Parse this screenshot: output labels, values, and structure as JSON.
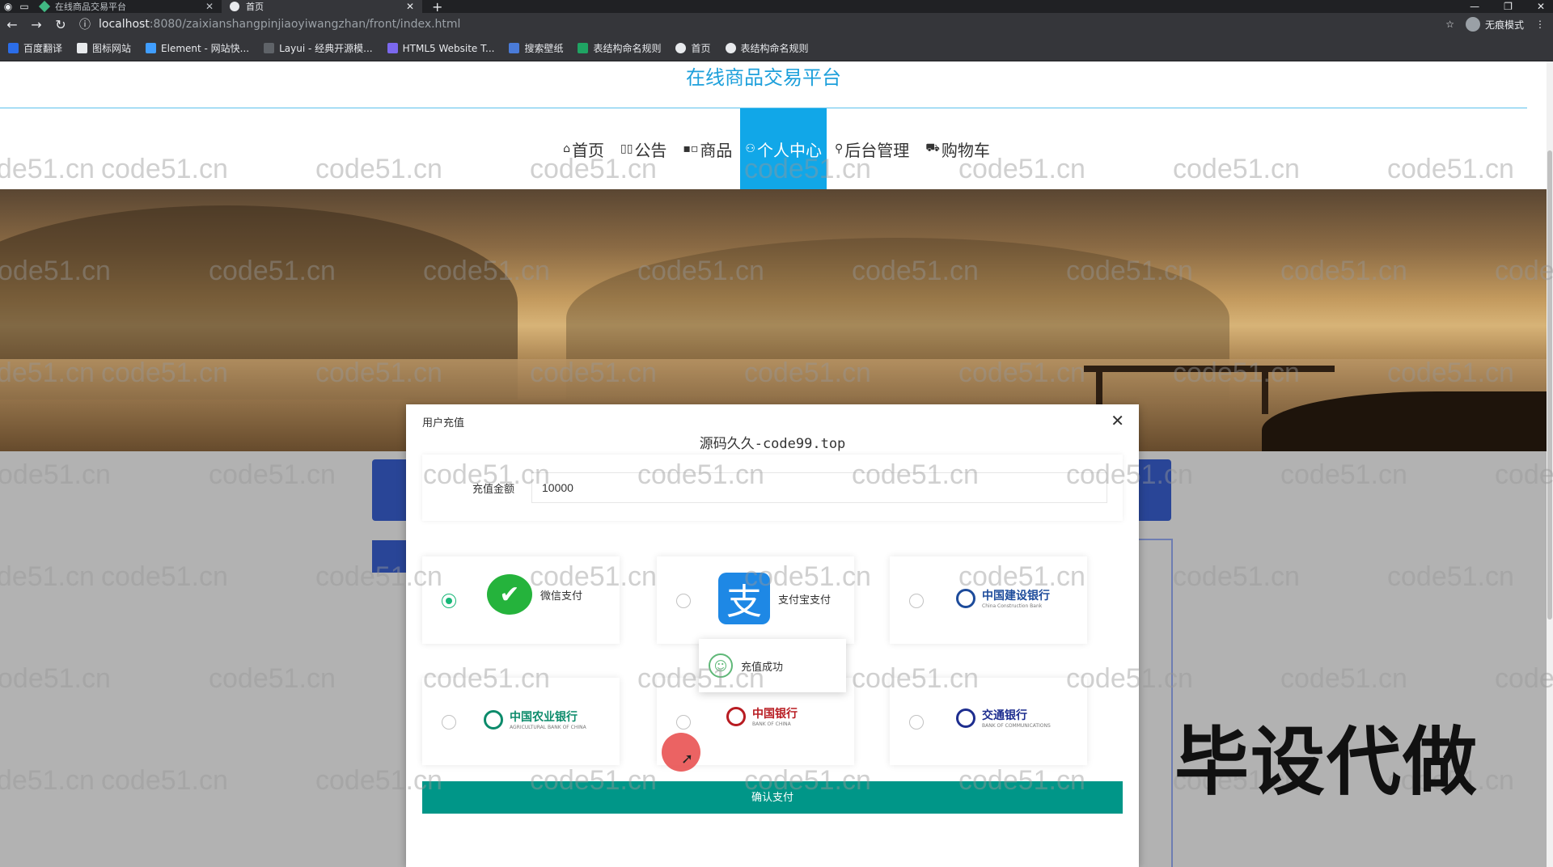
{
  "browser": {
    "tabs": [
      {
        "title": "在线商品交易平台",
        "active": false
      },
      {
        "title": "首页",
        "active": true
      }
    ],
    "url_host": "localhost",
    "url_path": ":8080/zaixianshangpinjiaoyiwangzhan/front/index.html",
    "profile_label": "无痕模式",
    "bookmarks": [
      "百度翻译",
      "图标网站",
      "Element - 网站快...",
      "Layui - 经典开源模...",
      "HTML5 Website T...",
      "搜索壁纸",
      "表结构命名规则",
      "首页",
      "表结构命名规则"
    ]
  },
  "site": {
    "title": "在线商品交易平台",
    "nav": [
      {
        "icon": "⌂",
        "label": "首页",
        "active": false
      },
      {
        "icon": "▯▯",
        "label": "公告",
        "active": false
      },
      {
        "icon": "▪▫",
        "label": "商品",
        "active": false
      },
      {
        "icon": "⚇",
        "label": "个人中心",
        "active": true
      },
      {
        "icon": "⚲",
        "label": "后台管理",
        "active": false
      },
      {
        "icon": "⛟",
        "label": "购物车",
        "active": false
      }
    ]
  },
  "modal": {
    "title": "用户充值",
    "watermark": "源码久久-code99.top",
    "amount_label": "充值金额",
    "amount_value": "10000",
    "payment_methods": [
      {
        "name": "微信支付",
        "selected": true
      },
      {
        "name": "支付宝支付",
        "selected": false
      },
      {
        "name": "中国建设银行",
        "sub": "China Construction Bank",
        "selected": false
      },
      {
        "name": "中国农业银行",
        "sub": "AGRICULTURAL BANK OF CHINA",
        "selected": false
      },
      {
        "name": "中国银行",
        "sub": "BANK OF CHINA",
        "selected": false
      },
      {
        "name": "交通银行",
        "sub": "BANK OF COMMUNICATIONS",
        "selected": false
      }
    ],
    "toast": "充值成功",
    "confirm_label": "确认支付"
  },
  "watermark_text": "code51.cn",
  "promo_text": "毕设代做",
  "colors": {
    "accent": "#11a7e8",
    "title": "#1ea0db",
    "confirm": "#009688",
    "radio_checked": "#16b777"
  }
}
